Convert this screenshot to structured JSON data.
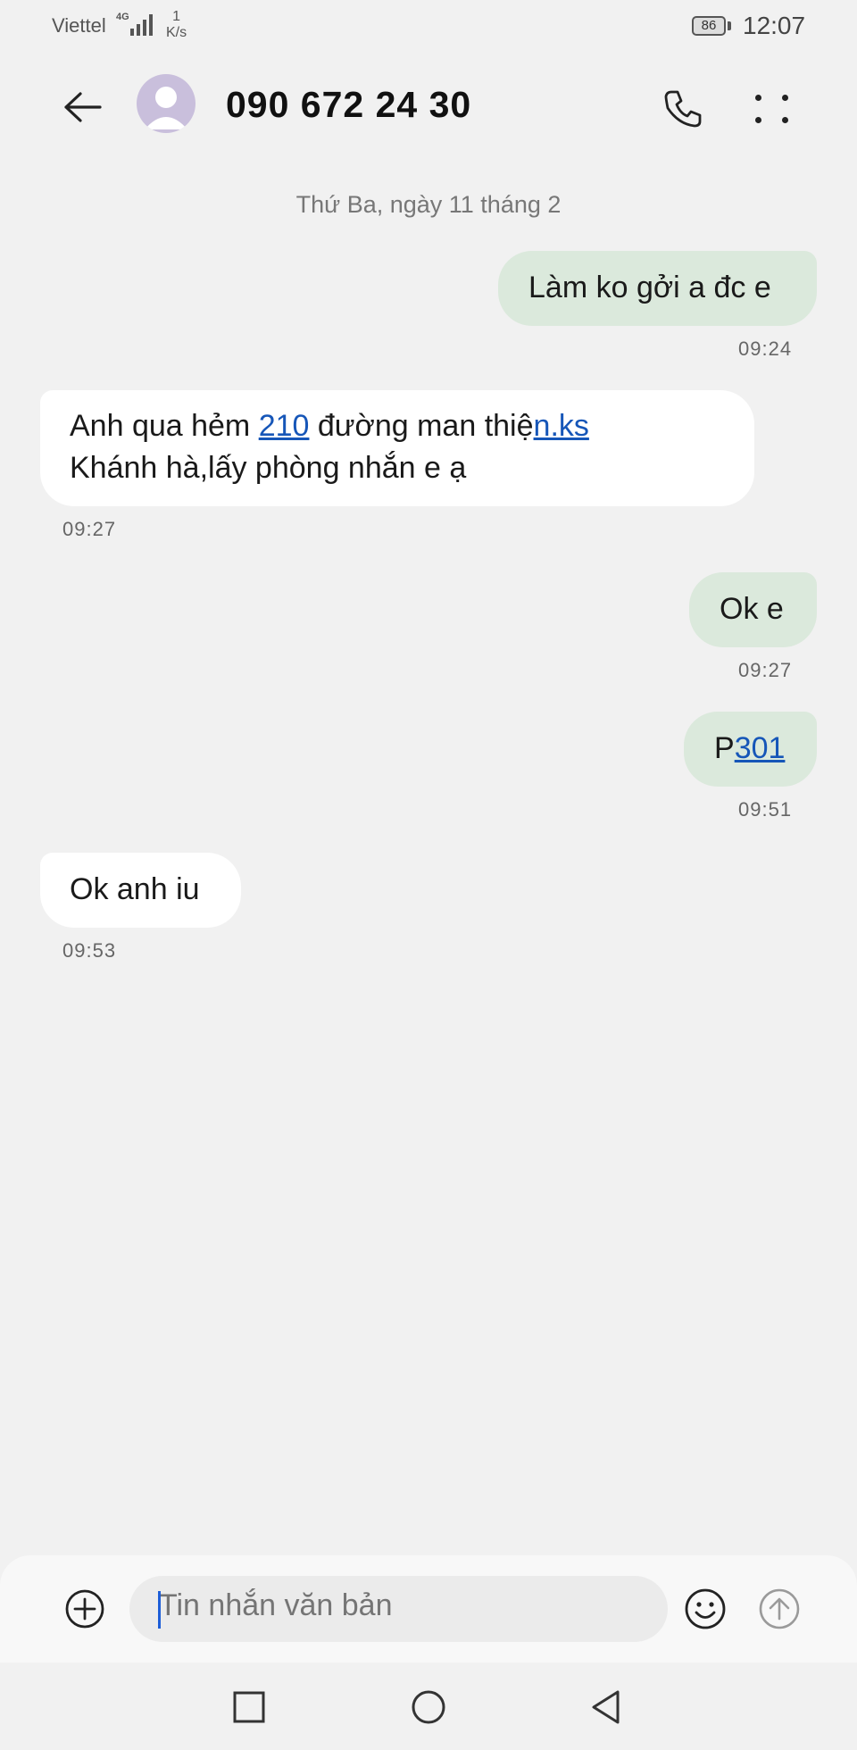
{
  "status_bar": {
    "carrier": "Viettel",
    "network": "4G",
    "speed_value": "1",
    "speed_unit": "K/s",
    "battery": "86",
    "time": "12:07"
  },
  "header": {
    "contact": "090 672 24 30",
    "icons": {
      "back": "back-arrow-icon",
      "avatar": "person-icon",
      "call": "phone-icon",
      "more": "more-dots-icon"
    }
  },
  "conversation": {
    "date": "Thứ Ba, ngày 11 tháng 2",
    "messages": [
      {
        "direction": "out",
        "text": "Làm ko gởi a đc e",
        "time": "09:24"
      },
      {
        "direction": "in",
        "line1_before": "Anh qua hẻm ",
        "line1_link1": "210",
        "line1_middle": " đường man thiệ",
        "line1_link2": "n.ks",
        "line2": "Khánh hà,lấy phòng nhắn e ạ",
        "time": "09:27"
      },
      {
        "direction": "out",
        "text": "Ok e",
        "time": "09:27"
      },
      {
        "direction": "out",
        "prefix": "P",
        "link": "301",
        "time": "09:51"
      },
      {
        "direction": "in",
        "text": "Ok anh iu",
        "time": "09:53"
      }
    ]
  },
  "composer": {
    "placeholder": "Tin nhắn văn bản",
    "icons": {
      "attach": "plus-circle-icon",
      "emoji": "emoji-icon",
      "send": "send-arrow-icon"
    }
  },
  "navbar": {
    "icons": {
      "recent": "square-icon",
      "home": "circle-icon",
      "back": "triangle-back-icon"
    }
  },
  "colors": {
    "background": "#f1f1f1",
    "outgoing_bubble": "#dbe9dc",
    "incoming_bubble": "#ffffff",
    "link": "#1656b8",
    "caret": "#1d5ed8"
  }
}
